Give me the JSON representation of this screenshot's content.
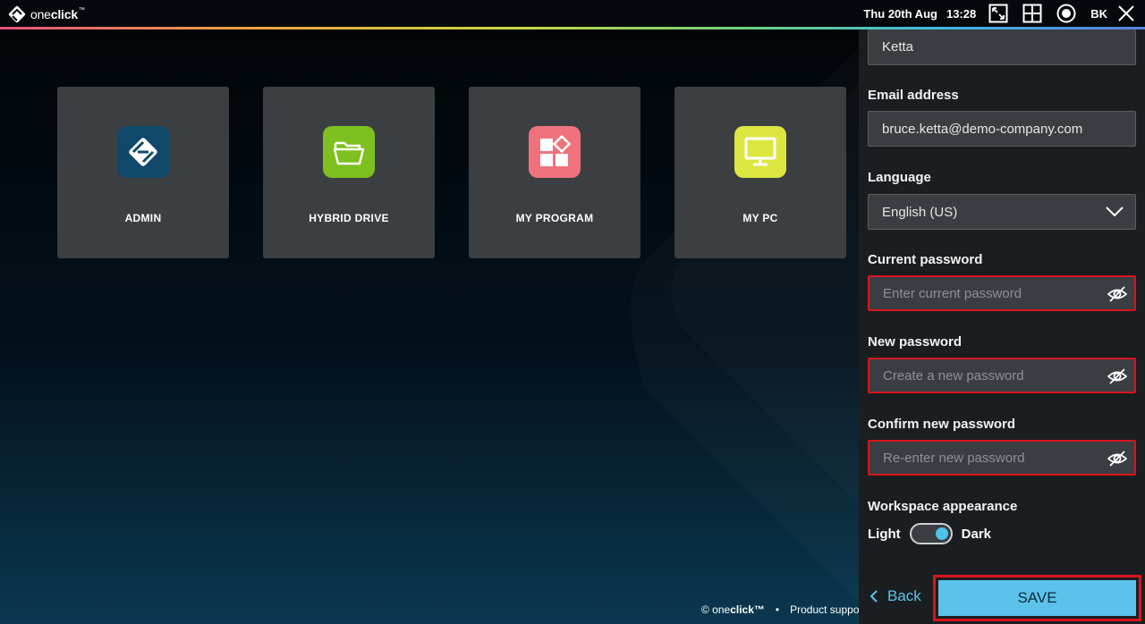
{
  "topbar": {
    "logo_text_light": "one",
    "logo_text_bold": "click",
    "logo_tm": "™",
    "date": "Thu 20th Aug",
    "time": "13:28",
    "icons": [
      "fullscreen-icon",
      "grid-icon",
      "record-icon",
      "close-icon"
    ],
    "initials": "BK"
  },
  "tiles": [
    {
      "label": "ADMIN",
      "icon": "admin-icon",
      "color": "#10486b"
    },
    {
      "label": "HYBRID DRIVE",
      "icon": "folder-icon",
      "color": "#7dc01f"
    },
    {
      "label": "MY PROGRAM",
      "icon": "program-icon",
      "color": "#f0727d"
    },
    {
      "label": "MY PC",
      "icon": "monitor-icon",
      "color": "#dde640"
    }
  ],
  "footer": {
    "copyright_prefix": "© one",
    "copyright_bold": "click™",
    "separator": "•",
    "link": "Product suppo"
  },
  "profile": {
    "last_name_value": "Ketta",
    "email_label": "Email address",
    "email_value": "bruce.ketta@demo-company.com",
    "language_label": "Language",
    "language_value": "English (US)",
    "current_password_label": "Current password",
    "current_password_placeholder": "Enter current password",
    "new_password_label": "New password",
    "new_password_placeholder": "Create a new password",
    "confirm_password_label": "Confirm new password",
    "confirm_password_placeholder": "Re-enter new password",
    "appearance_label": "Workspace appearance",
    "appearance_light": "Light",
    "appearance_dark": "Dark",
    "appearance_selected": "Dark",
    "back_label": "Back",
    "save_label": "SAVE"
  },
  "colors": {
    "accent": "#5bc3ea",
    "error_border": "#d9141c",
    "panel_bg": "#1b1e21",
    "tile_bg": "#3b3f42"
  }
}
